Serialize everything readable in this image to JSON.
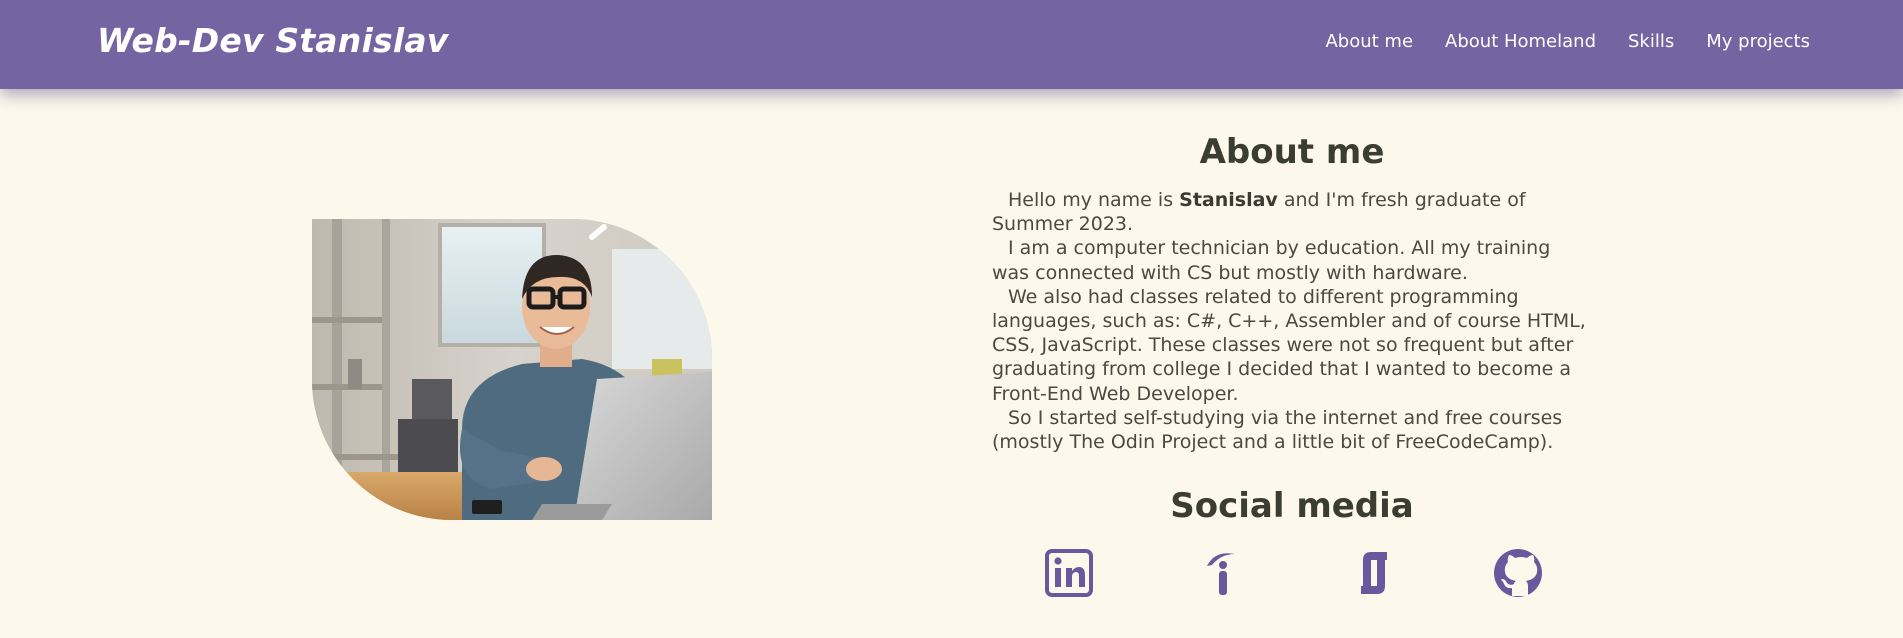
{
  "brand": "Web-Dev Stanislav",
  "nav": {
    "items": [
      {
        "label": "About me"
      },
      {
        "label": "About Homeland"
      },
      {
        "label": "Skills"
      },
      {
        "label": "My projects"
      }
    ]
  },
  "about": {
    "heading": "About me",
    "paragraphs": {
      "p1_pre": "Hello my name is ",
      "p1_name": "Stanislav",
      "p1_post": " and I'm fresh graduate of Summer 2023.",
      "p2": "I am a computer technician by education. All my training was connected with CS but mostly with hardware.",
      "p3": "We also had classes related to different programming languages, such as: C#, C++, Assembler and of course HTML, CSS, JavaScript. These classes were not so frequent but after graduating from college I decided that I wanted to become a Front-End Web Developer.",
      "p4": "So I started self-studying via the internet and free courses (mostly The Odin Project and a little bit of FreeCodeCamp)."
    }
  },
  "social": {
    "heading": "Social media",
    "icons": [
      "linkedin-icon",
      "indeed-icon",
      "glassdoor-icon",
      "github-icon"
    ],
    "icon_color": "#6a589e"
  },
  "colors": {
    "navbar": "#7464a1",
    "background": "#fcf8eb",
    "heading": "#3a3d31"
  }
}
